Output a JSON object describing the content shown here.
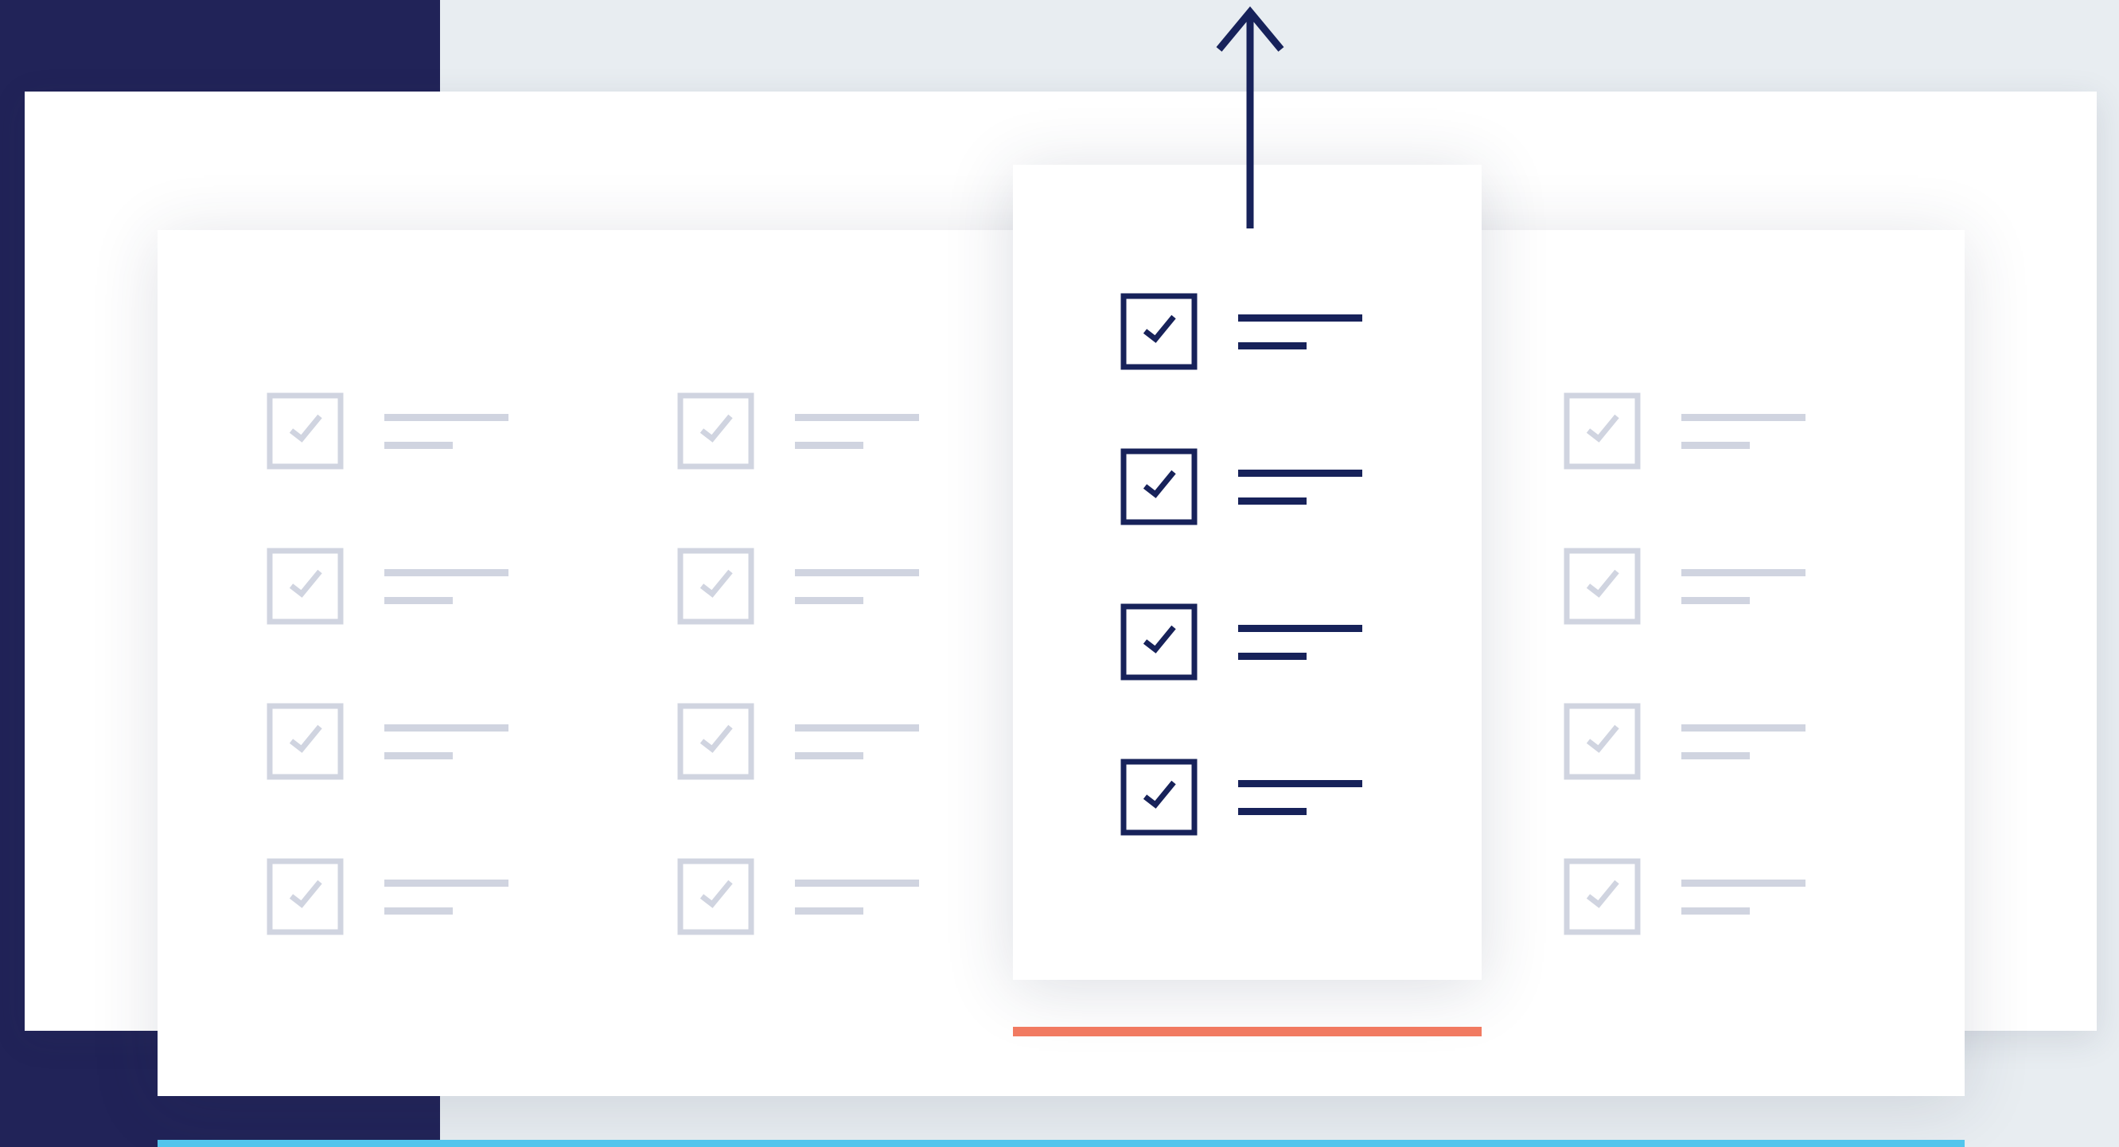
{
  "colors": {
    "navy": "#212358",
    "check_active": "#17225a",
    "check_dim": "#d0d4e0",
    "accent_orange": "#f17a61",
    "accent_blue": "#52c5ec",
    "background": "#e8edf1"
  },
  "icons": {
    "checkbox": "checked-checkbox-icon",
    "arrow": "arrow-up-icon"
  },
  "columns": [
    {
      "name": "column-1",
      "state": "dim",
      "item_count": 4
    },
    {
      "name": "column-2",
      "state": "dim",
      "item_count": 4
    },
    {
      "name": "column-highlighted",
      "state": "active",
      "item_count": 4
    },
    {
      "name": "column-4",
      "state": "dim",
      "item_count": 4
    }
  ]
}
